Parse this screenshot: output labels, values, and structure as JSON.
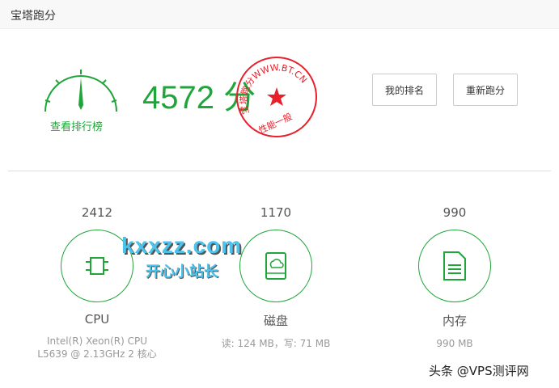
{
  "window": {
    "title": "宝塔跑分"
  },
  "summary": {
    "rank_link": "查看排行榜",
    "score": "4572",
    "score_unit": "分",
    "stamp_ring": "宝塔跑分WWW.BT.CN",
    "stamp_rating": "性能一般"
  },
  "buttons": {
    "my_rank": "我的排名",
    "rerun": "重新跑分"
  },
  "items": [
    {
      "score": "2412",
      "name": "CPU",
      "desc": "Intel(R) Xeon(R) CPU L5639 @ 2.13GHz 2 核心",
      "icon": "cpu-icon"
    },
    {
      "score": "1170",
      "name": "磁盘",
      "desc": "读: 124 MB，写: 71 MB",
      "icon": "disk-icon"
    },
    {
      "score": "990",
      "name": "内存",
      "desc": "990 MB",
      "icon": "memory-icon"
    }
  ],
  "watermark": {
    "site": "kxxzz.com",
    "site_sub": "开心小站长",
    "toutiao": "头条 @VPS测评网"
  },
  "colors": {
    "accent": "#20a53a",
    "stamp": "#e8202a"
  }
}
